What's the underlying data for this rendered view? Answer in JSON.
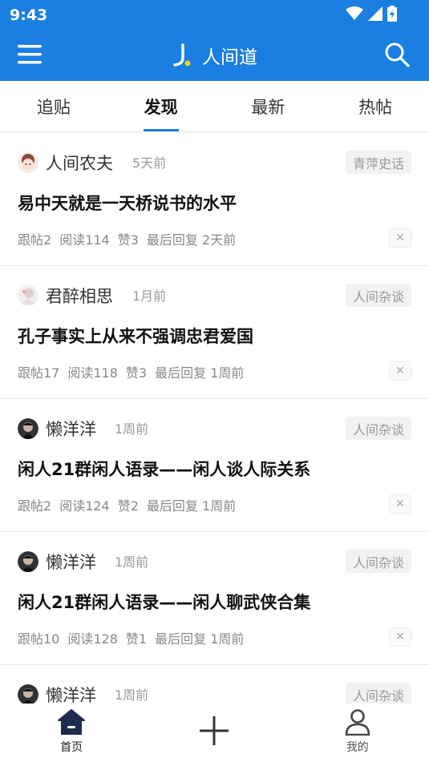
{
  "status_bar": {
    "time": "9:43"
  },
  "header": {
    "title": "人间道"
  },
  "tabs": [
    {
      "label": "追贴",
      "active": false
    },
    {
      "label": "发现",
      "active": true
    },
    {
      "label": "最新",
      "active": false
    },
    {
      "label": "热帖",
      "active": false
    }
  ],
  "posts": [
    {
      "author": "人间农夫",
      "time": "5天前",
      "category": "青萍史话",
      "title": "易中天就是一天桥说书的水平",
      "replies": "跟帖2",
      "reads": "阅读114",
      "likes": "赞3",
      "last_reply": "最后回复 2天前"
    },
    {
      "author": "君醉相思",
      "time": "1月前",
      "category": "人间杂谈",
      "title": "孔子事实上从来不强调忠君爱国",
      "replies": "跟帖17",
      "reads": "阅读118",
      "likes": "赞3",
      "last_reply": "最后回复 1周前"
    },
    {
      "author": "懒洋洋",
      "time": "1周前",
      "category": "人间杂谈",
      "title": "闲人21群闲人语录——闲人谈人际关系",
      "replies": "跟帖2",
      "reads": "阅读124",
      "likes": "赞2",
      "last_reply": "最后回复 1周前"
    },
    {
      "author": "懒洋洋",
      "time": "1周前",
      "category": "人间杂谈",
      "title": "闲人21群闲人语录——闲人聊武侠合集",
      "replies": "跟帖10",
      "reads": "阅读128",
      "likes": "赞1",
      "last_reply": "最后回复 1周前"
    },
    {
      "author": "懒洋洋",
      "time": "1周前",
      "category": "人间杂谈",
      "title": "",
      "replies": "",
      "reads": "",
      "likes": "",
      "last_reply": ""
    }
  ],
  "bottom_nav": {
    "home_label": "首页",
    "mine_label": "我的"
  },
  "colors": {
    "brand": "#1a7fe0",
    "tab_indicator": "#1a7fe0",
    "badge_bg": "#f2f2f2"
  }
}
